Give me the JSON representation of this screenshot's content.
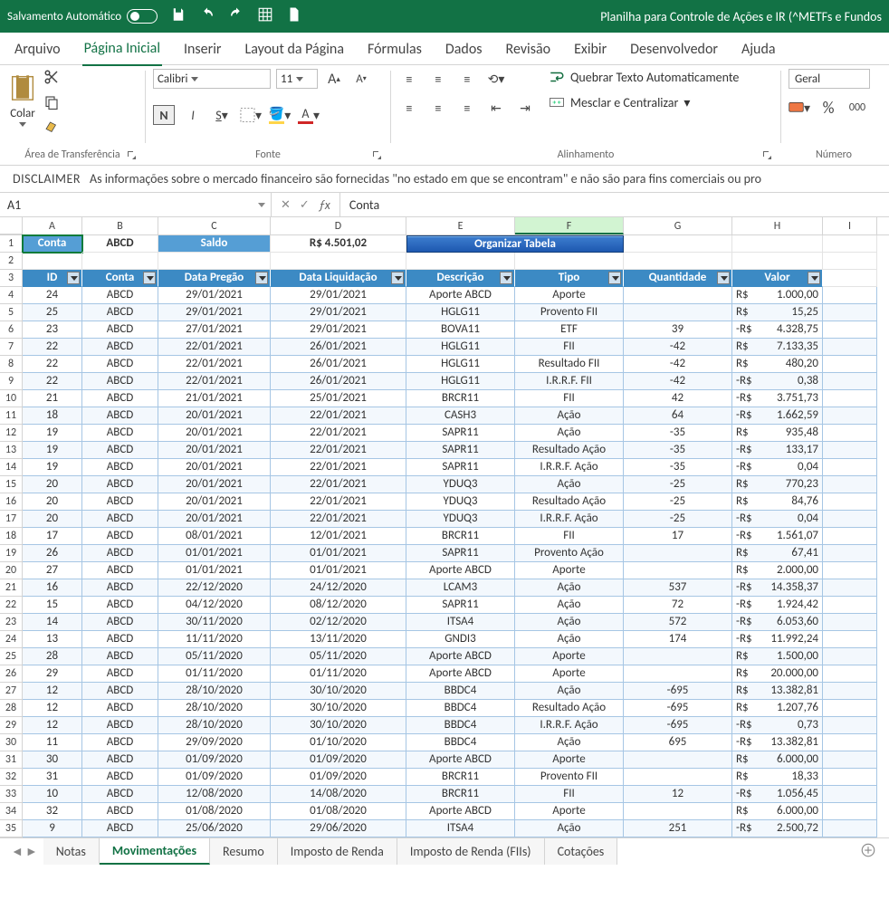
{
  "titlebar": {
    "autosave": "Salvamento Automático",
    "doc_title": "Planilha para Controle de Ações e IR (^METFs e Fundos"
  },
  "menu": {
    "tabs": [
      "Arquivo",
      "Página Inicial",
      "Inserir",
      "Layout da Página",
      "Fórmulas",
      "Dados",
      "Revisão",
      "Exibir",
      "Desenvolvedor",
      "Ajuda"
    ],
    "active": 1
  },
  "ribbon": {
    "clipboard": {
      "paste": "Colar",
      "group": "Área de Transferência"
    },
    "font": {
      "name": "Calibri",
      "size": "11",
      "group": "Fonte"
    },
    "align": {
      "wrap": "Quebrar Texto Automaticamente",
      "merge": "Mesclar e Centralizar",
      "group": "Alinhamento"
    },
    "number": {
      "format": "Geral",
      "pct_zeros": "000",
      "group": "Número"
    }
  },
  "disclaimer": {
    "label": "DISCLAIMER",
    "text": "As informações sobre o mercado financeiro são fornecidas \"no estado em que se encontram\" e não são para fins comerciais ou pro"
  },
  "formula_bar": {
    "name": "A1",
    "content": "Conta"
  },
  "sheets": {
    "tabs": [
      "Notas",
      "Movimentações",
      "Resumo",
      "Imposto de Renda",
      "Imposto de Renda (FIIs)",
      "Cotações"
    ],
    "active": 1
  },
  "grid": {
    "cols": [
      "A",
      "B",
      "C",
      "D",
      "E",
      "F",
      "G",
      "H",
      "I"
    ],
    "row1": {
      "conta": "Conta",
      "abcd": "ABCD",
      "saldo": "Saldo",
      "valor": "R$ 4.501,02",
      "org": "Organizar Tabela"
    },
    "headers": [
      "ID",
      "Conta",
      "Data Pregão",
      "Data Liquidação",
      "Descrição",
      "Tipo",
      "Quantidade",
      "Valor"
    ],
    "rows": [
      {
        "rn": 4,
        "id": "24",
        "conta": "ABCD",
        "dp": "29/01/2021",
        "dl": "29/01/2021",
        "desc": "Aporte ABCD",
        "tipo": "Aporte",
        "qtd": "",
        "cur": "R$",
        "val": "1.000,00"
      },
      {
        "rn": 5,
        "id": "25",
        "conta": "ABCD",
        "dp": "29/01/2021",
        "dl": "29/01/2021",
        "desc": "HGLG11",
        "tipo": "Provento FII",
        "qtd": "",
        "cur": "R$",
        "val": "15,25"
      },
      {
        "rn": 6,
        "id": "23",
        "conta": "ABCD",
        "dp": "27/01/2021",
        "dl": "29/01/2021",
        "desc": "BOVA11",
        "tipo": "ETF",
        "qtd": "39",
        "cur": "-R$",
        "val": "4.328,75"
      },
      {
        "rn": 7,
        "id": "22",
        "conta": "ABCD",
        "dp": "22/01/2021",
        "dl": "26/01/2021",
        "desc": "HGLG11",
        "tipo": "FII",
        "qtd": "-42",
        "cur": "R$",
        "val": "7.133,35"
      },
      {
        "rn": 8,
        "id": "22",
        "conta": "ABCD",
        "dp": "22/01/2021",
        "dl": "26/01/2021",
        "desc": "HGLG11",
        "tipo": "Resultado FII",
        "qtd": "-42",
        "cur": "R$",
        "val": "480,20"
      },
      {
        "rn": 9,
        "id": "22",
        "conta": "ABCD",
        "dp": "22/01/2021",
        "dl": "26/01/2021",
        "desc": "HGLG11",
        "tipo": "I.R.R.F. FII",
        "qtd": "-42",
        "cur": "-R$",
        "val": "0,38"
      },
      {
        "rn": 10,
        "id": "21",
        "conta": "ABCD",
        "dp": "21/01/2021",
        "dl": "25/01/2021",
        "desc": "BRCR11",
        "tipo": "FII",
        "qtd": "42",
        "cur": "-R$",
        "val": "3.751,73"
      },
      {
        "rn": 11,
        "id": "18",
        "conta": "ABCD",
        "dp": "20/01/2021",
        "dl": "22/01/2021",
        "desc": "CASH3",
        "tipo": "Ação",
        "qtd": "64",
        "cur": "-R$",
        "val": "1.662,59"
      },
      {
        "rn": 12,
        "id": "19",
        "conta": "ABCD",
        "dp": "20/01/2021",
        "dl": "22/01/2021",
        "desc": "SAPR11",
        "tipo": "Ação",
        "qtd": "-35",
        "cur": "R$",
        "val": "935,48"
      },
      {
        "rn": 13,
        "id": "19",
        "conta": "ABCD",
        "dp": "20/01/2021",
        "dl": "22/01/2021",
        "desc": "SAPR11",
        "tipo": "Resultado Ação",
        "qtd": "-35",
        "cur": "-R$",
        "val": "133,17"
      },
      {
        "rn": 14,
        "id": "19",
        "conta": "ABCD",
        "dp": "20/01/2021",
        "dl": "22/01/2021",
        "desc": "SAPR11",
        "tipo": "I.R.R.F. Ação",
        "qtd": "-35",
        "cur": "-R$",
        "val": "0,04"
      },
      {
        "rn": 15,
        "id": "20",
        "conta": "ABCD",
        "dp": "20/01/2021",
        "dl": "22/01/2021",
        "desc": "YDUQ3",
        "tipo": "Ação",
        "qtd": "-25",
        "cur": "R$",
        "val": "770,23"
      },
      {
        "rn": 16,
        "id": "20",
        "conta": "ABCD",
        "dp": "20/01/2021",
        "dl": "22/01/2021",
        "desc": "YDUQ3",
        "tipo": "Resultado Ação",
        "qtd": "-25",
        "cur": "R$",
        "val": "84,76"
      },
      {
        "rn": 17,
        "id": "20",
        "conta": "ABCD",
        "dp": "20/01/2021",
        "dl": "22/01/2021",
        "desc": "YDUQ3",
        "tipo": "I.R.R.F. Ação",
        "qtd": "-25",
        "cur": "-R$",
        "val": "0,04"
      },
      {
        "rn": 18,
        "id": "17",
        "conta": "ABCD",
        "dp": "08/01/2021",
        "dl": "12/01/2021",
        "desc": "BRCR11",
        "tipo": "FII",
        "qtd": "17",
        "cur": "-R$",
        "val": "1.561,07"
      },
      {
        "rn": 19,
        "id": "26",
        "conta": "ABCD",
        "dp": "01/01/2021",
        "dl": "01/01/2021",
        "desc": "SAPR11",
        "tipo": "Provento Ação",
        "qtd": "",
        "cur": "R$",
        "val": "67,41"
      },
      {
        "rn": 20,
        "id": "27",
        "conta": "ABCD",
        "dp": "01/01/2021",
        "dl": "01/01/2021",
        "desc": "Aporte ABCD",
        "tipo": "Aporte",
        "qtd": "",
        "cur": "R$",
        "val": "2.000,00"
      },
      {
        "rn": 21,
        "id": "16",
        "conta": "ABCD",
        "dp": "22/12/2020",
        "dl": "24/12/2020",
        "desc": "LCAM3",
        "tipo": "Ação",
        "qtd": "537",
        "cur": "-R$",
        "val": "14.358,37"
      },
      {
        "rn": 22,
        "id": "15",
        "conta": "ABCD",
        "dp": "04/12/2020",
        "dl": "08/12/2020",
        "desc": "SAPR11",
        "tipo": "Ação",
        "qtd": "72",
        "cur": "-R$",
        "val": "1.924,42"
      },
      {
        "rn": 23,
        "id": "14",
        "conta": "ABCD",
        "dp": "30/11/2020",
        "dl": "02/12/2020",
        "desc": "ITSA4",
        "tipo": "Ação",
        "qtd": "572",
        "cur": "-R$",
        "val": "6.053,60"
      },
      {
        "rn": 24,
        "id": "13",
        "conta": "ABCD",
        "dp": "11/11/2020",
        "dl": "13/11/2020",
        "desc": "GNDI3",
        "tipo": "Ação",
        "qtd": "174",
        "cur": "-R$",
        "val": "11.992,24"
      },
      {
        "rn": 25,
        "id": "28",
        "conta": "ABCD",
        "dp": "05/11/2020",
        "dl": "05/11/2020",
        "desc": "Aporte ABCD",
        "tipo": "Aporte",
        "qtd": "",
        "cur": "R$",
        "val": "1.500,00"
      },
      {
        "rn": 26,
        "id": "29",
        "conta": "ABCD",
        "dp": "01/11/2020",
        "dl": "01/11/2020",
        "desc": "Aporte ABCD",
        "tipo": "Aporte",
        "qtd": "",
        "cur": "R$",
        "val": "20.000,00"
      },
      {
        "rn": 27,
        "id": "12",
        "conta": "ABCD",
        "dp": "28/10/2020",
        "dl": "30/10/2020",
        "desc": "BBDC4",
        "tipo": "Ação",
        "qtd": "-695",
        "cur": "R$",
        "val": "13.382,81"
      },
      {
        "rn": 28,
        "id": "12",
        "conta": "ABCD",
        "dp": "28/10/2020",
        "dl": "30/10/2020",
        "desc": "BBDC4",
        "tipo": "Resultado Ação",
        "qtd": "-695",
        "cur": "R$",
        "val": "1.207,76"
      },
      {
        "rn": 29,
        "id": "12",
        "conta": "ABCD",
        "dp": "28/10/2020",
        "dl": "30/10/2020",
        "desc": "BBDC4",
        "tipo": "I.R.R.F. Ação",
        "qtd": "-695",
        "cur": "-R$",
        "val": "0,73"
      },
      {
        "rn": 30,
        "id": "11",
        "conta": "ABCD",
        "dp": "29/09/2020",
        "dl": "01/10/2020",
        "desc": "BBDC4",
        "tipo": "Ação",
        "qtd": "695",
        "cur": "-R$",
        "val": "13.382,81"
      },
      {
        "rn": 31,
        "id": "30",
        "conta": "ABCD",
        "dp": "01/09/2020",
        "dl": "01/09/2020",
        "desc": "Aporte ABCD",
        "tipo": "Aporte",
        "qtd": "",
        "cur": "R$",
        "val": "6.000,00"
      },
      {
        "rn": 32,
        "id": "31",
        "conta": "ABCD",
        "dp": "01/09/2020",
        "dl": "01/09/2020",
        "desc": "BRCR11",
        "tipo": "Provento FII",
        "qtd": "",
        "cur": "R$",
        "val": "18,33"
      },
      {
        "rn": 33,
        "id": "10",
        "conta": "ABCD",
        "dp": "12/08/2020",
        "dl": "14/08/2020",
        "desc": "BRCR11",
        "tipo": "FII",
        "qtd": "12",
        "cur": "-R$",
        "val": "1.056,45"
      },
      {
        "rn": 34,
        "id": "32",
        "conta": "ABCD",
        "dp": "01/08/2020",
        "dl": "01/08/2020",
        "desc": "Aporte ABCD",
        "tipo": "Aporte",
        "qtd": "",
        "cur": "R$",
        "val": "6.000,00"
      },
      {
        "rn": 35,
        "id": "9",
        "conta": "ABCD",
        "dp": "25/06/2020",
        "dl": "29/06/2020",
        "desc": "ITSA4",
        "tipo": "Ação",
        "qtd": "251",
        "cur": "-R$",
        "val": "2.500,72"
      }
    ]
  }
}
